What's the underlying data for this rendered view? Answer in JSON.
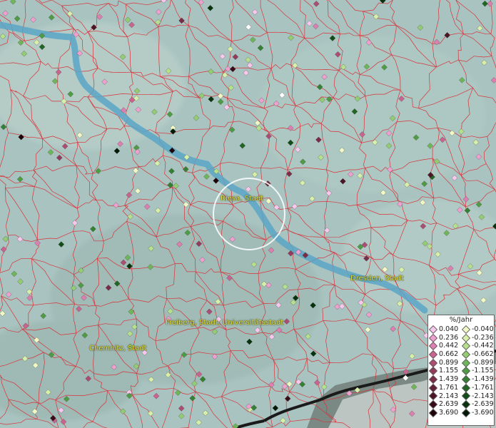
{
  "map": {
    "cities": [
      {
        "id": "riesa",
        "label": "Riesa, Stadt"
      },
      {
        "id": "dresden",
        "label": "Dresden, Stadt"
      },
      {
        "id": "freiberg",
        "label": "Freiberg, Stadt, Universitätsstadt"
      },
      {
        "id": "chemnitz",
        "label": "Chemnitz, Stadt"
      }
    ],
    "colors": {
      "background": "#a9c4c0",
      "river": "#5aa6c6",
      "boundaries": "#d8333a",
      "border_dark": "#1a1a1a"
    }
  },
  "legend": {
    "title": "%/Jahr",
    "positive": [
      {
        "label": "0.040",
        "color": "#f7c8ec"
      },
      {
        "label": "0.236",
        "color": "#eea0cf"
      },
      {
        "label": "0.442",
        "color": "#de7fb1"
      },
      {
        "label": "0.662",
        "color": "#c8648f"
      },
      {
        "label": "0.899",
        "color": "#ac4d73"
      },
      {
        "label": "1.155",
        "color": "#913c5c"
      },
      {
        "label": "1.439",
        "color": "#7a2c48"
      },
      {
        "label": "1.761",
        "color": "#651f35"
      },
      {
        "label": "2.143",
        "color": "#4f1424"
      },
      {
        "label": "2.639",
        "color": "#380b16"
      },
      {
        "label": "3.690",
        "color": "#1d0409"
      }
    ],
    "negative": [
      {
        "label": "-0.040",
        "color": "#f1f8c5"
      },
      {
        "label": "-0.236",
        "color": "#d7efa8"
      },
      {
        "label": "-0.442",
        "color": "#b7e08d"
      },
      {
        "label": "-0.662",
        "color": "#93cc72"
      },
      {
        "label": "-0.899",
        "color": "#6fb65a"
      },
      {
        "label": "-1.155",
        "color": "#4e9c44"
      },
      {
        "label": "-1.439",
        "color": "#368033"
      },
      {
        "label": "-1.761",
        "color": "#216625"
      },
      {
        "label": "-2.143",
        "color": "#124d18"
      },
      {
        "label": "-2.639",
        "color": "#07330c"
      },
      {
        "label": "-3.690",
        "color": "#021a05"
      }
    ]
  }
}
